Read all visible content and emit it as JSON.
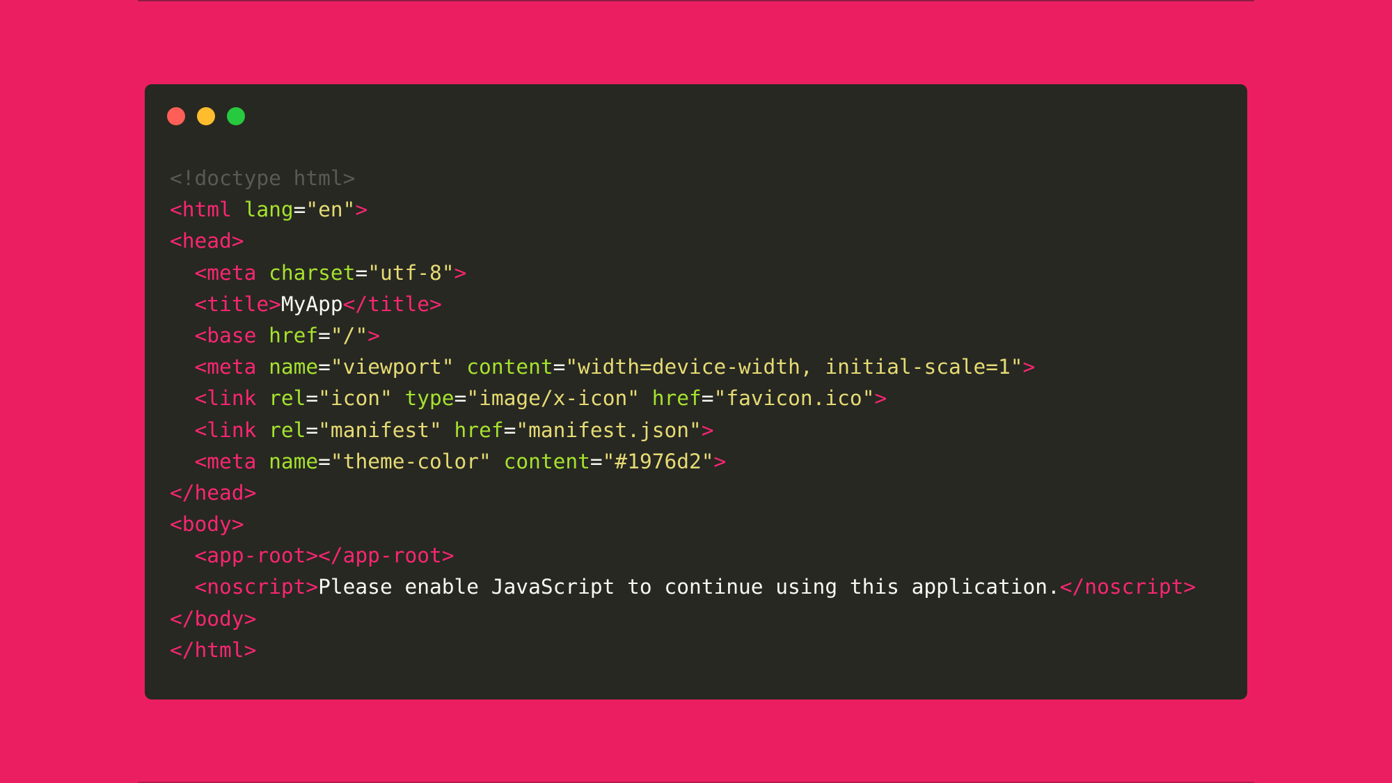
{
  "colors": {
    "background": "#EC1E62",
    "window": "#272822",
    "comment": "#595A52",
    "tag": "#F92672",
    "attribute": "#A6E22E",
    "string": "#E6DB74",
    "text": "#F8F8F2"
  },
  "window_controls": [
    {
      "name": "close-dot",
      "color": "#FF5F56"
    },
    {
      "name": "minimize-dot",
      "color": "#FFBD2E"
    },
    {
      "name": "zoom-dot",
      "color": "#27C93F"
    }
  ],
  "code_lines": [
    [
      {
        "t": "comment",
        "v": "<!doctype html>"
      }
    ],
    [
      {
        "t": "tag",
        "v": "<html"
      },
      {
        "t": "text",
        "v": " "
      },
      {
        "t": "attr",
        "v": "lang"
      },
      {
        "t": "eq",
        "v": "="
      },
      {
        "t": "str",
        "v": "\"en\""
      },
      {
        "t": "tag",
        "v": ">"
      }
    ],
    [
      {
        "t": "tag",
        "v": "<head>"
      }
    ],
    [
      {
        "t": "text",
        "v": "  "
      },
      {
        "t": "tag",
        "v": "<meta"
      },
      {
        "t": "text",
        "v": " "
      },
      {
        "t": "attr",
        "v": "charset"
      },
      {
        "t": "eq",
        "v": "="
      },
      {
        "t": "str",
        "v": "\"utf-8\""
      },
      {
        "t": "tag",
        "v": ">"
      }
    ],
    [
      {
        "t": "text",
        "v": "  "
      },
      {
        "t": "tag",
        "v": "<title>"
      },
      {
        "t": "text",
        "v": "MyApp"
      },
      {
        "t": "tag",
        "v": "</title>"
      }
    ],
    [
      {
        "t": "text",
        "v": "  "
      },
      {
        "t": "tag",
        "v": "<base"
      },
      {
        "t": "text",
        "v": " "
      },
      {
        "t": "attr",
        "v": "href"
      },
      {
        "t": "eq",
        "v": "="
      },
      {
        "t": "str",
        "v": "\"/\""
      },
      {
        "t": "tag",
        "v": ">"
      }
    ],
    [
      {
        "t": "text",
        "v": "  "
      },
      {
        "t": "tag",
        "v": "<meta"
      },
      {
        "t": "text",
        "v": " "
      },
      {
        "t": "attr",
        "v": "name"
      },
      {
        "t": "eq",
        "v": "="
      },
      {
        "t": "str",
        "v": "\"viewport\""
      },
      {
        "t": "text",
        "v": " "
      },
      {
        "t": "attr",
        "v": "content"
      },
      {
        "t": "eq",
        "v": "="
      },
      {
        "t": "str",
        "v": "\"width=device-width, initial-scale=1\""
      },
      {
        "t": "tag",
        "v": ">"
      }
    ],
    [
      {
        "t": "text",
        "v": "  "
      },
      {
        "t": "tag",
        "v": "<link"
      },
      {
        "t": "text",
        "v": " "
      },
      {
        "t": "attr",
        "v": "rel"
      },
      {
        "t": "eq",
        "v": "="
      },
      {
        "t": "str",
        "v": "\"icon\""
      },
      {
        "t": "text",
        "v": " "
      },
      {
        "t": "attr",
        "v": "type"
      },
      {
        "t": "eq",
        "v": "="
      },
      {
        "t": "str",
        "v": "\"image/x-icon\""
      },
      {
        "t": "text",
        "v": " "
      },
      {
        "t": "attr",
        "v": "href"
      },
      {
        "t": "eq",
        "v": "="
      },
      {
        "t": "str",
        "v": "\"favicon.ico\""
      },
      {
        "t": "tag",
        "v": ">"
      }
    ],
    [
      {
        "t": "text",
        "v": "  "
      },
      {
        "t": "tag",
        "v": "<link"
      },
      {
        "t": "text",
        "v": " "
      },
      {
        "t": "attr",
        "v": "rel"
      },
      {
        "t": "eq",
        "v": "="
      },
      {
        "t": "str",
        "v": "\"manifest\""
      },
      {
        "t": "text",
        "v": " "
      },
      {
        "t": "attr",
        "v": "href"
      },
      {
        "t": "eq",
        "v": "="
      },
      {
        "t": "str",
        "v": "\"manifest.json\""
      },
      {
        "t": "tag",
        "v": ">"
      }
    ],
    [
      {
        "t": "text",
        "v": "  "
      },
      {
        "t": "tag",
        "v": "<meta"
      },
      {
        "t": "text",
        "v": " "
      },
      {
        "t": "attr",
        "v": "name"
      },
      {
        "t": "eq",
        "v": "="
      },
      {
        "t": "str",
        "v": "\"theme-color\""
      },
      {
        "t": "text",
        "v": " "
      },
      {
        "t": "attr",
        "v": "content"
      },
      {
        "t": "eq",
        "v": "="
      },
      {
        "t": "str",
        "v": "\"#1976d2\""
      },
      {
        "t": "tag",
        "v": ">"
      }
    ],
    [
      {
        "t": "tag",
        "v": "</head>"
      }
    ],
    [
      {
        "t": "tag",
        "v": "<body>"
      }
    ],
    [
      {
        "t": "text",
        "v": "  "
      },
      {
        "t": "tag",
        "v": "<app-root></app-root>"
      }
    ],
    [
      {
        "t": "text",
        "v": "  "
      },
      {
        "t": "tag",
        "v": "<noscript>"
      },
      {
        "t": "text",
        "v": "Please enable JavaScript to continue using this application."
      },
      {
        "t": "tag",
        "v": "</noscript>"
      }
    ],
    [
      {
        "t": "tag",
        "v": "</body>"
      }
    ],
    [
      {
        "t": "tag",
        "v": "</html>"
      }
    ]
  ]
}
